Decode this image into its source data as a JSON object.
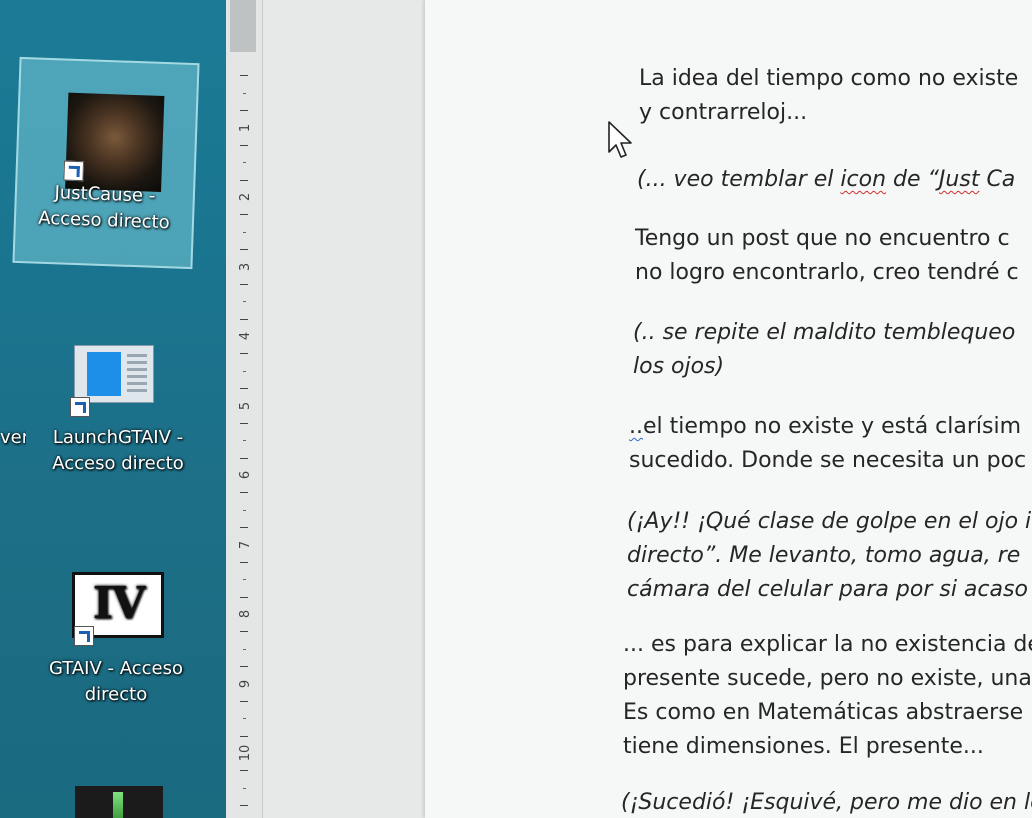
{
  "desktop": {
    "icons": [
      {
        "label_line1": "JustCause -",
        "label_line2": "Acceso directo"
      },
      {
        "label_line1": "LaunchGTAIV -",
        "label_line2": "Acceso directo"
      },
      {
        "label_line1": "GTAIV - Acceso",
        "label_line2": "directo",
        "logo_text": "IV"
      }
    ],
    "partial_label": "ver"
  },
  "ruler": {
    "numbers": [
      "1",
      "2",
      "3",
      "4",
      "5",
      "6",
      "7",
      "8",
      "9",
      "10"
    ]
  },
  "document": {
    "p1": {
      "line1": "La idea del tiempo como no existe",
      "line2": "y contrarreloj..."
    },
    "p2": {
      "pre": "(... veo temblar el ",
      "w1": "icon",
      "mid": " de “",
      "w2": "Just",
      "post": " Ca"
    },
    "p3": {
      "line1": "Tengo un post que no encuentro c",
      "line2": "no logro encontrarlo, creo tendré c"
    },
    "p4": {
      "line1": "(.. se repite el maldito temblequeo",
      "line2": "los ojos)"
    },
    "p5": {
      "mark": "..",
      "line1_rest": "el tiempo no existe y está clarísim",
      "line2": "sucedido. Donde se necesita un poc"
    },
    "p6": {
      "line1": "(¡Ay!! ¡Qué clase de golpe en el ojo i",
      "line2": "directo”.  Me levanto, tomo agua, re",
      "line3": "cámara del celular para por si acaso"
    },
    "p7": {
      "line1": "... es para explicar la no existencia de",
      "line2": "presente sucede, pero no existe, una",
      "line3": "Es como en Matemáticas abstraerse",
      "line4": "tiene dimensiones. El presente..."
    },
    "p8": {
      "line1": "(¡Sucedió! ¡Esquivé, pero me dio en lo"
    }
  }
}
